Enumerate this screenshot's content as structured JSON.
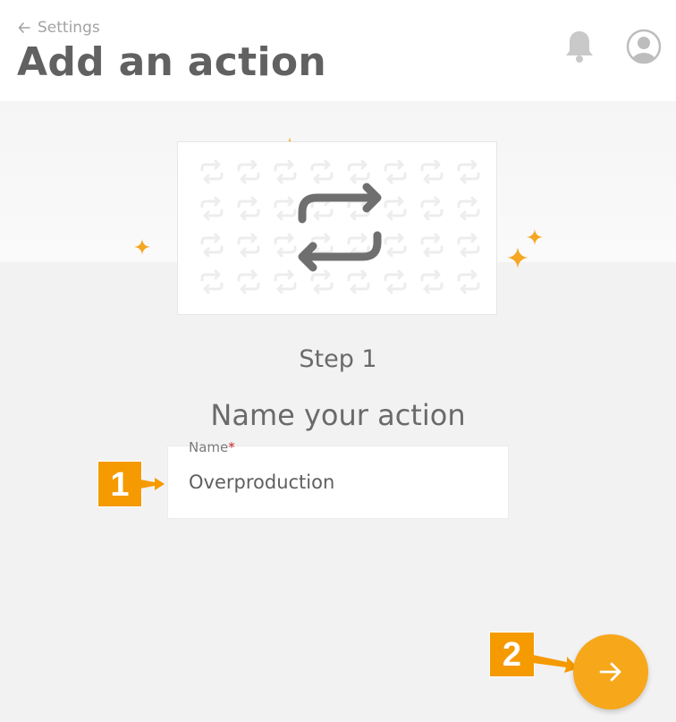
{
  "header": {
    "back_label": "Settings",
    "title": "Add an action",
    "icons": [
      "arrow-left-icon",
      "bell-icon",
      "user-avatar-icon"
    ]
  },
  "illustration": {
    "icon": "repeat-icon",
    "decoration": "sparkle-icon"
  },
  "step": {
    "label": "Step 1",
    "heading": "Name your action"
  },
  "form": {
    "name_label": "Name",
    "required_marker": "*",
    "name_value": "Overproduction"
  },
  "callouts": [
    "1",
    "2"
  ],
  "next_button": {
    "icon": "arrow-right-icon"
  },
  "colors": {
    "accent": "#f7a71a",
    "callout": "#f59a00",
    "title": "#616161",
    "required": "#c62828",
    "background": "#f2f2f2"
  }
}
